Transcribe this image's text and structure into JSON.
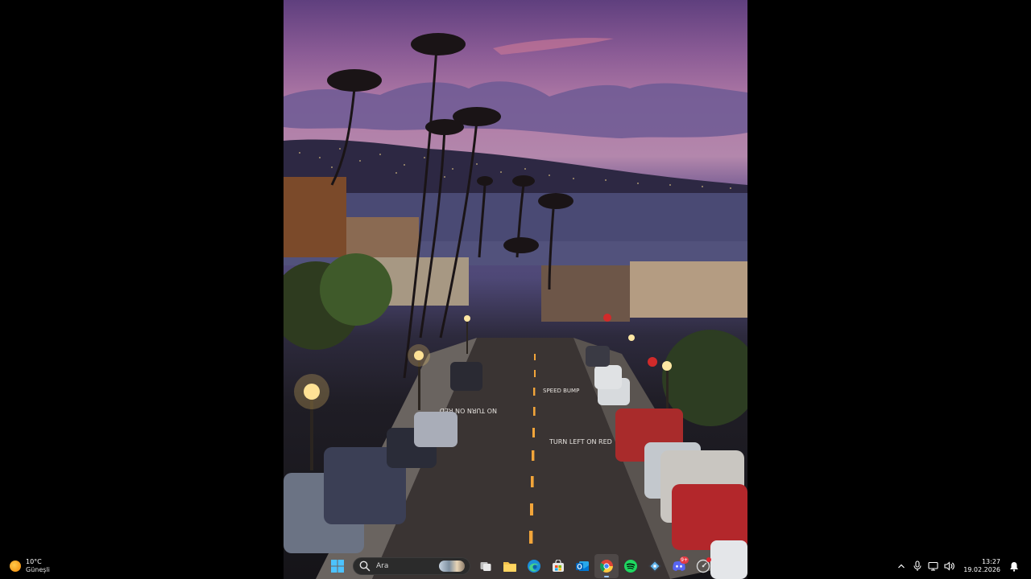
{
  "desktop": {
    "wallpaper_road_text": [
      "NO TURN ON RED",
      "SPEED BUMP",
      "TURN LEFT ON RED"
    ]
  },
  "taskbar": {
    "weather": {
      "temperature": "10°C",
      "condition": "Güneşli",
      "icon": "sun-icon"
    },
    "start": {
      "icon": "windows-start-icon"
    },
    "search": {
      "placeholder": "Ara",
      "icon": "search-icon"
    },
    "apps": [
      {
        "name": "task-view",
        "icon": "task-view-icon"
      },
      {
        "name": "file-explorer",
        "icon": "folder-icon"
      },
      {
        "name": "edge",
        "icon": "edge-icon"
      },
      {
        "name": "microsoft-store",
        "icon": "store-icon"
      },
      {
        "name": "outlook",
        "icon": "outlook-icon"
      },
      {
        "name": "chrome",
        "icon": "chrome-icon",
        "active": true
      },
      {
        "name": "spotify",
        "icon": "spotify-icon"
      },
      {
        "name": "app-diamond",
        "icon": "diamond-icon"
      },
      {
        "name": "discord",
        "icon": "discord-icon",
        "badge": "9+"
      },
      {
        "name": "app-gauge",
        "icon": "gauge-icon",
        "badge_dot": true
      }
    ],
    "tray": {
      "icons": [
        "chevron-up-icon",
        "microphone-icon",
        "network-icon",
        "speaker-icon"
      ],
      "time": "13:27",
      "date": "19.02.2026",
      "notification_icon": "notification-icon"
    }
  },
  "colors": {
    "taskbar_bg": "#000000",
    "chrome_active_indicator": "#9fc8ff",
    "badge_red": "#e43b44"
  }
}
